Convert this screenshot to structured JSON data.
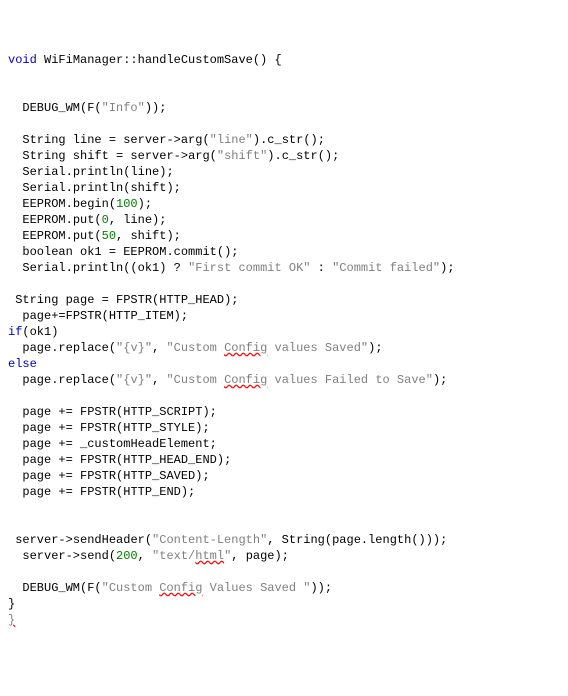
{
  "lines": [
    {
      "t": [
        {
          "c": "kw",
          "s": "void"
        },
        {
          "c": "nm",
          "s": " WiFiManager"
        },
        {
          "c": "op",
          "s": "::"
        },
        {
          "c": "nm",
          "s": "handleCustomSave"
        },
        {
          "c": "op",
          "s": "() {"
        }
      ]
    },
    {
      "t": []
    },
    {
      "t": []
    },
    {
      "t": [
        {
          "c": "nm",
          "s": "  DEBUG_WM"
        },
        {
          "c": "op",
          "s": "("
        },
        {
          "c": "nm",
          "s": "F"
        },
        {
          "c": "op",
          "s": "("
        },
        {
          "c": "str",
          "s": "\"Info\""
        },
        {
          "c": "op",
          "s": "));"
        }
      ]
    },
    {
      "t": []
    },
    {
      "t": [
        {
          "c": "nm",
          "s": "  String line "
        },
        {
          "c": "op",
          "s": "="
        },
        {
          "c": "nm",
          "s": " server"
        },
        {
          "c": "op",
          "s": "->"
        },
        {
          "c": "nm",
          "s": "arg"
        },
        {
          "c": "op",
          "s": "("
        },
        {
          "c": "str",
          "s": "\"line\""
        },
        {
          "c": "op",
          "s": ")."
        },
        {
          "c": "nm",
          "s": "c_str"
        },
        {
          "c": "op",
          "s": "();"
        }
      ]
    },
    {
      "t": [
        {
          "c": "nm",
          "s": "  String shift "
        },
        {
          "c": "op",
          "s": "="
        },
        {
          "c": "nm",
          "s": " server"
        },
        {
          "c": "op",
          "s": "->"
        },
        {
          "c": "nm",
          "s": "arg"
        },
        {
          "c": "op",
          "s": "("
        },
        {
          "c": "str",
          "s": "\"shift\""
        },
        {
          "c": "op",
          "s": ")."
        },
        {
          "c": "nm",
          "s": "c_str"
        },
        {
          "c": "op",
          "s": "();"
        }
      ]
    },
    {
      "t": [
        {
          "c": "nm",
          "s": "  Serial"
        },
        {
          "c": "op",
          "s": "."
        },
        {
          "c": "nm",
          "s": "println"
        },
        {
          "c": "op",
          "s": "("
        },
        {
          "c": "nm",
          "s": "line"
        },
        {
          "c": "op",
          "s": ");"
        }
      ]
    },
    {
      "t": [
        {
          "c": "nm",
          "s": "  Serial"
        },
        {
          "c": "op",
          "s": "."
        },
        {
          "c": "nm",
          "s": "println"
        },
        {
          "c": "op",
          "s": "("
        },
        {
          "c": "nm",
          "s": "shift"
        },
        {
          "c": "op",
          "s": ");"
        }
      ]
    },
    {
      "t": [
        {
          "c": "nm",
          "s": "  EEPROM"
        },
        {
          "c": "op",
          "s": "."
        },
        {
          "c": "nm",
          "s": "begin"
        },
        {
          "c": "op",
          "s": "("
        },
        {
          "c": "num",
          "s": "100"
        },
        {
          "c": "op",
          "s": ");"
        }
      ]
    },
    {
      "t": [
        {
          "c": "nm",
          "s": "  EEPROM"
        },
        {
          "c": "op",
          "s": "."
        },
        {
          "c": "nm",
          "s": "put"
        },
        {
          "c": "op",
          "s": "("
        },
        {
          "c": "num",
          "s": "0"
        },
        {
          "c": "op",
          "s": ", "
        },
        {
          "c": "nm",
          "s": "line"
        },
        {
          "c": "op",
          "s": ");"
        }
      ]
    },
    {
      "t": [
        {
          "c": "nm",
          "s": "  EEPROM"
        },
        {
          "c": "op",
          "s": "."
        },
        {
          "c": "nm",
          "s": "put"
        },
        {
          "c": "op",
          "s": "("
        },
        {
          "c": "num",
          "s": "50"
        },
        {
          "c": "op",
          "s": ", "
        },
        {
          "c": "nm",
          "s": "shift"
        },
        {
          "c": "op",
          "s": ");"
        }
      ]
    },
    {
      "t": [
        {
          "c": "nm",
          "s": "  boolean ok1 "
        },
        {
          "c": "op",
          "s": "="
        },
        {
          "c": "nm",
          "s": " EEPROM"
        },
        {
          "c": "op",
          "s": "."
        },
        {
          "c": "nm",
          "s": "commit"
        },
        {
          "c": "op",
          "s": "();"
        }
      ]
    },
    {
      "t": [
        {
          "c": "nm",
          "s": "  Serial"
        },
        {
          "c": "op",
          "s": "."
        },
        {
          "c": "nm",
          "s": "println"
        },
        {
          "c": "op",
          "s": "(("
        },
        {
          "c": "nm",
          "s": "ok1"
        },
        {
          "c": "op",
          "s": ") ? "
        },
        {
          "c": "str",
          "s": "\"First commit OK\""
        },
        {
          "c": "op",
          "s": " : "
        },
        {
          "c": "str",
          "s": "\"Commit failed\""
        },
        {
          "c": "op",
          "s": ");"
        }
      ]
    },
    {
      "t": []
    },
    {
      "t": [
        {
          "c": "nm",
          "s": " String page "
        },
        {
          "c": "op",
          "s": "="
        },
        {
          "c": "nm",
          "s": " FPSTR"
        },
        {
          "c": "op",
          "s": "("
        },
        {
          "c": "nm",
          "s": "HTTP_HEAD"
        },
        {
          "c": "op",
          "s": ");"
        }
      ]
    },
    {
      "t": [
        {
          "c": "nm",
          "s": "  page"
        },
        {
          "c": "op",
          "s": "+="
        },
        {
          "c": "nm",
          "s": "FPSTR"
        },
        {
          "c": "op",
          "s": "("
        },
        {
          "c": "nm",
          "s": "HTTP_ITEM"
        },
        {
          "c": "op",
          "s": ");"
        }
      ]
    },
    {
      "t": [
        {
          "c": "kw",
          "s": "if"
        },
        {
          "c": "op",
          "s": "("
        },
        {
          "c": "nm",
          "s": "ok1"
        },
        {
          "c": "op",
          "s": ")"
        }
      ]
    },
    {
      "t": [
        {
          "c": "nm",
          "s": "  page"
        },
        {
          "c": "op",
          "s": "."
        },
        {
          "c": "nm",
          "s": "replace"
        },
        {
          "c": "op",
          "s": "("
        },
        {
          "c": "str",
          "s": "\"{v}\""
        },
        {
          "c": "op",
          "s": ", "
        },
        {
          "c": "str",
          "s": "\"Custom "
        },
        {
          "c": "sq",
          "s": "Config"
        },
        {
          "c": "str",
          "s": " values Saved\""
        },
        {
          "c": "op",
          "s": ");"
        }
      ]
    },
    {
      "t": [
        {
          "c": "kw",
          "s": "else"
        }
      ]
    },
    {
      "t": [
        {
          "c": "nm",
          "s": "  page"
        },
        {
          "c": "op",
          "s": "."
        },
        {
          "c": "nm",
          "s": "replace"
        },
        {
          "c": "op",
          "s": "("
        },
        {
          "c": "str",
          "s": "\"{v}\""
        },
        {
          "c": "op",
          "s": ", "
        },
        {
          "c": "str",
          "s": "\"Custom "
        },
        {
          "c": "sq",
          "s": "Config"
        },
        {
          "c": "str",
          "s": " values Failed to Save\""
        },
        {
          "c": "op",
          "s": ");"
        }
      ]
    },
    {
      "t": []
    },
    {
      "t": [
        {
          "c": "nm",
          "s": "  page "
        },
        {
          "c": "op",
          "s": "+="
        },
        {
          "c": "nm",
          "s": " FPSTR"
        },
        {
          "c": "op",
          "s": "("
        },
        {
          "c": "nm",
          "s": "HTTP_SCRIPT"
        },
        {
          "c": "op",
          "s": ");"
        }
      ]
    },
    {
      "t": [
        {
          "c": "nm",
          "s": "  page "
        },
        {
          "c": "op",
          "s": "+="
        },
        {
          "c": "nm",
          "s": " FPSTR"
        },
        {
          "c": "op",
          "s": "("
        },
        {
          "c": "nm",
          "s": "HTTP_STYLE"
        },
        {
          "c": "op",
          "s": ");"
        }
      ]
    },
    {
      "t": [
        {
          "c": "nm",
          "s": "  page "
        },
        {
          "c": "op",
          "s": "+="
        },
        {
          "c": "nm",
          "s": " _customHeadElement"
        },
        {
          "c": "op",
          "s": ";"
        }
      ]
    },
    {
      "t": [
        {
          "c": "nm",
          "s": "  page "
        },
        {
          "c": "op",
          "s": "+="
        },
        {
          "c": "nm",
          "s": " FPSTR"
        },
        {
          "c": "op",
          "s": "("
        },
        {
          "c": "nm",
          "s": "HTTP_HEAD_END"
        },
        {
          "c": "op",
          "s": ");"
        }
      ]
    },
    {
      "t": [
        {
          "c": "nm",
          "s": "  page "
        },
        {
          "c": "op",
          "s": "+="
        },
        {
          "c": "nm",
          "s": " FPSTR"
        },
        {
          "c": "op",
          "s": "("
        },
        {
          "c": "nm",
          "s": "HTTP_SAVED"
        },
        {
          "c": "op",
          "s": ");"
        }
      ]
    },
    {
      "t": [
        {
          "c": "nm",
          "s": "  page "
        },
        {
          "c": "op",
          "s": "+="
        },
        {
          "c": "nm",
          "s": " FPSTR"
        },
        {
          "c": "op",
          "s": "("
        },
        {
          "c": "nm",
          "s": "HTTP_END"
        },
        {
          "c": "op",
          "s": ");"
        }
      ]
    },
    {
      "t": []
    },
    {
      "t": []
    },
    {
      "t": [
        {
          "c": "nm",
          "s": " server"
        },
        {
          "c": "op",
          "s": "->"
        },
        {
          "c": "nm",
          "s": "sendHeader"
        },
        {
          "c": "op",
          "s": "("
        },
        {
          "c": "str",
          "s": "\"Content-Length\""
        },
        {
          "c": "op",
          "s": ", "
        },
        {
          "c": "nm",
          "s": "String"
        },
        {
          "c": "op",
          "s": "("
        },
        {
          "c": "nm",
          "s": "page"
        },
        {
          "c": "op",
          "s": "."
        },
        {
          "c": "nm",
          "s": "length"
        },
        {
          "c": "op",
          "s": "()));"
        }
      ]
    },
    {
      "t": [
        {
          "c": "nm",
          "s": "  server"
        },
        {
          "c": "op",
          "s": "->"
        },
        {
          "c": "nm",
          "s": "send"
        },
        {
          "c": "op",
          "s": "("
        },
        {
          "c": "num",
          "s": "200"
        },
        {
          "c": "op",
          "s": ", "
        },
        {
          "c": "str",
          "s": "\"text/"
        },
        {
          "c": "sq",
          "s": "html"
        },
        {
          "c": "str",
          "s": "\""
        },
        {
          "c": "op",
          "s": ", "
        },
        {
          "c": "nm",
          "s": "page"
        },
        {
          "c": "op",
          "s": ");"
        }
      ]
    },
    {
      "t": []
    },
    {
      "t": [
        {
          "c": "nm",
          "s": "  DEBUG_WM"
        },
        {
          "c": "op",
          "s": "("
        },
        {
          "c": "nm",
          "s": "F"
        },
        {
          "c": "op",
          "s": "("
        },
        {
          "c": "str",
          "s": "\"Custom "
        },
        {
          "c": "sq",
          "s": "Config"
        },
        {
          "c": "str",
          "s": " Values Saved \""
        },
        {
          "c": "op",
          "s": "));"
        }
      ]
    },
    {
      "t": [
        {
          "c": "op",
          "s": "}"
        }
      ]
    },
    {
      "t": [
        {
          "c": "sq",
          "s": "}"
        }
      ]
    }
  ]
}
